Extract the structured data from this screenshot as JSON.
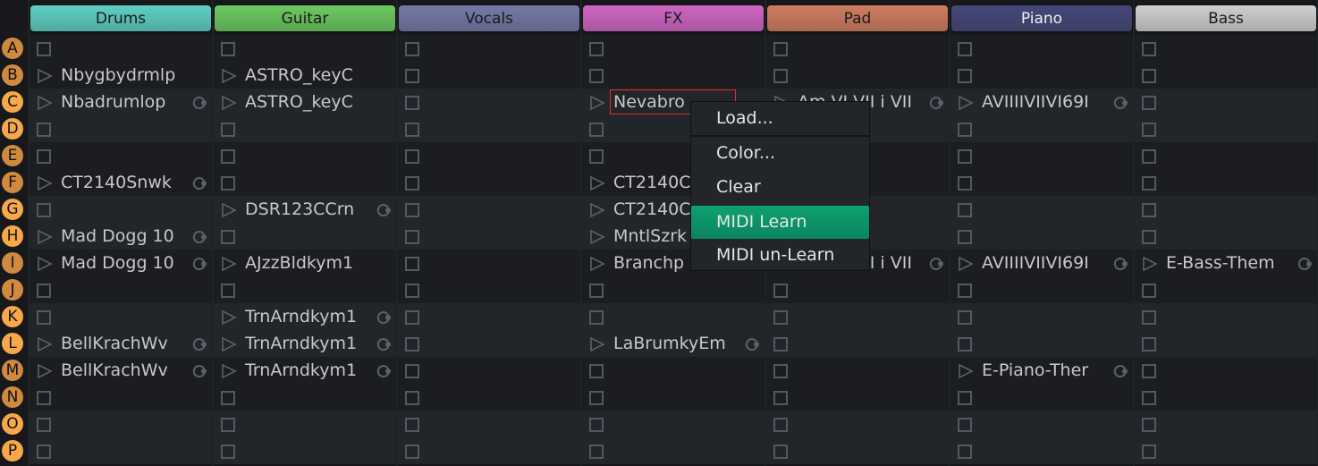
{
  "row_letters": [
    "A",
    "B",
    "C",
    "D",
    "E",
    "F",
    "G",
    "H",
    "I",
    "J",
    "K",
    "L",
    "M",
    "N",
    "O",
    "P"
  ],
  "colors": {
    "row_dark": "#1b1d20",
    "row_light": "#222529",
    "letter_dark": "#cf8a3e",
    "letter_light": "#f7a849",
    "menu_highlight": "#0e9a6a",
    "selection": "#e03030"
  },
  "tracks": [
    {
      "name": "Drums",
      "color": "#5fcfc3",
      "text_color": "#1a1a1a",
      "cells": [
        null,
        {
          "name": "Nbygbydrmlp",
          "loop": false
        },
        {
          "name": "Nbadrumlop",
          "loop": true
        },
        null,
        null,
        {
          "name": "CT2140Snwk",
          "loop": true
        },
        null,
        {
          "name": "Mad Dogg 10",
          "loop": true
        },
        {
          "name": "Mad Dogg 10",
          "loop": true
        },
        null,
        null,
        {
          "name": "BellKrachWv",
          "loop": true
        },
        {
          "name": "BellKrachWv",
          "loop": true
        },
        null,
        null,
        null
      ]
    },
    {
      "name": "Guitar",
      "color": "#6cc960",
      "text_color": "#1a1a1a",
      "cells": [
        null,
        {
          "name": "ASTRO_keyC",
          "loop": false
        },
        {
          "name": "ASTRO_keyC",
          "loop": false
        },
        null,
        null,
        null,
        {
          "name": "DSR123CCrn",
          "loop": true
        },
        null,
        {
          "name": "AJzzBldkym1",
          "loop": false
        },
        null,
        {
          "name": "TrnArndkym1",
          "loop": true
        },
        {
          "name": "TrnArndkym1",
          "loop": true
        },
        {
          "name": "TrnArndkym1",
          "loop": true
        },
        null,
        null,
        null
      ]
    },
    {
      "name": "Vocals",
      "color": "#7579a5",
      "text_color": "#1a1a1a",
      "cells": [
        null,
        null,
        null,
        null,
        null,
        null,
        null,
        null,
        null,
        null,
        null,
        null,
        null,
        null,
        null,
        null
      ]
    },
    {
      "name": "FX",
      "color": "#cf65c3",
      "text_color": "#1a1a1a",
      "cells": [
        null,
        null,
        {
          "name": "Nevabro",
          "loop": false,
          "selected": true
        },
        null,
        null,
        {
          "name": "CT2140C",
          "loop": false
        },
        {
          "name": "CT2140C",
          "loop": false
        },
        {
          "name": "MntlSzrk",
          "loop": false
        },
        {
          "name": "Branchp",
          "loop": false
        },
        null,
        null,
        {
          "name": "LaBrumkyEm",
          "loop": true
        },
        null,
        null,
        null,
        null
      ]
    },
    {
      "name": "Pad",
      "color": "#cf7d60",
      "text_color": "#1a1a1a",
      "cells": [
        null,
        null,
        {
          "name": "Am VI VII i VII",
          "loop": true
        },
        null,
        null,
        null,
        null,
        null,
        {
          "name": "Am VI VII i VII",
          "loop": true
        },
        null,
        null,
        null,
        null,
        null,
        null,
        null
      ]
    },
    {
      "name": "Piano",
      "color": "#454879",
      "text_color": "#f0f0f0",
      "cells": [
        null,
        null,
        {
          "name": "AVIIIIVIIVI69I",
          "loop": true
        },
        null,
        null,
        null,
        null,
        null,
        {
          "name": "AVIIIIVIIVI69I",
          "loop": true
        },
        null,
        null,
        null,
        {
          "name": "E-Piano-Ther",
          "loop": true
        },
        null,
        null,
        null
      ]
    },
    {
      "name": "Bass",
      "color": "#cfcfcf",
      "text_color": "#1a1a1a",
      "cells": [
        null,
        null,
        null,
        null,
        null,
        null,
        null,
        null,
        {
          "name": "E-Bass-Them",
          "loop": true
        },
        null,
        null,
        null,
        null,
        null,
        null,
        null
      ]
    }
  ],
  "context_menu": {
    "items": [
      "Load...",
      "Color...",
      "Clear",
      "MIDI Learn",
      "MIDI un-Learn"
    ],
    "highlighted": "MIDI Learn"
  }
}
